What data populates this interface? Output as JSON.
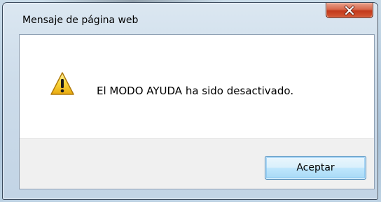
{
  "dialog": {
    "title": "Mensaje de página web",
    "message": "El MODO AYUDA ha sido desactivado.",
    "ok_label": "Aceptar",
    "close_glyph": "X",
    "icon": "warning-icon"
  },
  "colors": {
    "close_button": "#c2391b",
    "ok_button_border": "#3c7fb1",
    "button_area": "#f0f0f0",
    "warning_yellow": "#f6c514"
  }
}
